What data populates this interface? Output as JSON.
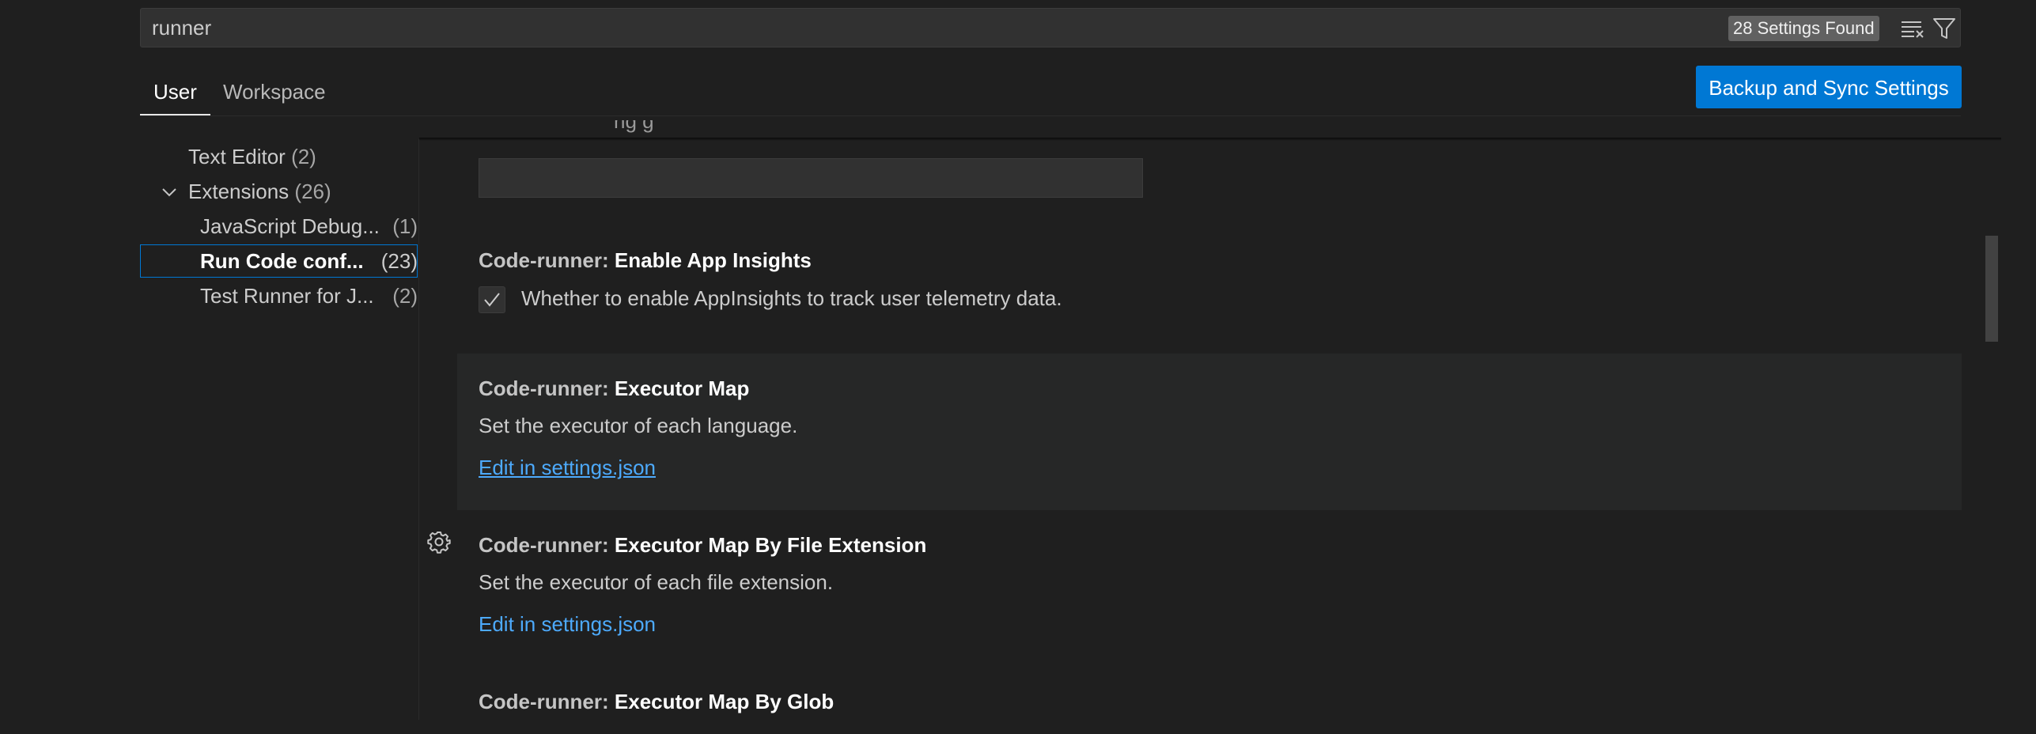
{
  "search": {
    "value": "runner",
    "results_badge": "28 Settings Found"
  },
  "tabs": [
    {
      "label": "User"
    },
    {
      "label": "Workspace"
    }
  ],
  "sync_button": "Backup and Sync Settings",
  "toc": {
    "items": [
      {
        "label": "Text Editor",
        "count": "(2)"
      },
      {
        "label": "Extensions",
        "count": "(26)"
      },
      {
        "label": "JavaScript Debug...",
        "count": "(1)"
      },
      {
        "label": "Run Code conf...",
        "count": "(23)"
      },
      {
        "label": "Test Runner for J...",
        "count": "(2)"
      }
    ]
  },
  "settings": [
    {
      "category": "Code-runner: ",
      "name": "Enable App Insights",
      "checkbox_label": "Whether to enable AppInsights to track user telemetry data.",
      "checked": true
    },
    {
      "category": "Code-runner: ",
      "name": "Executor Map",
      "description": "Set the executor of each language.",
      "link": "Edit in settings.json"
    },
    {
      "category": "Code-runner: ",
      "name": "Executor Map By File Extension",
      "description": "Set the executor of each file extension.",
      "link": "Edit in settings.json"
    },
    {
      "category": "Code-runner: ",
      "name": "Executor Map By Glob"
    }
  ],
  "partial_above": "ng g",
  "colors": {
    "accent": "#0078d4",
    "link": "#4daafc",
    "background": "#1f1f1f"
  }
}
